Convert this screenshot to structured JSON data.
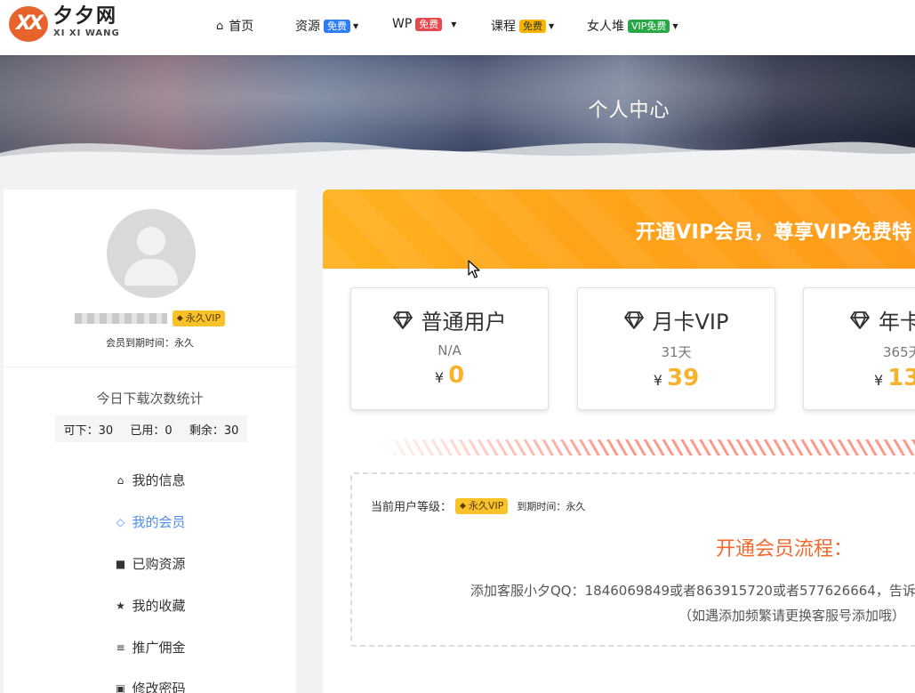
{
  "logo": {
    "mark": "XX",
    "cn": "夕夕网",
    "en": "XI XI WANG",
    "color": "#e8622b"
  },
  "nav": [
    {
      "label": "首页",
      "icon": "home-icon"
    },
    {
      "label": "资源",
      "tag": "免费",
      "tag_color": "blue"
    },
    {
      "label": "WP",
      "tag": "免费",
      "tag_color": "red"
    },
    {
      "label": "课程",
      "tag": "免费",
      "tag_color": "yellow"
    },
    {
      "label": "女人堆",
      "tag": "VIP免费",
      "tag_color": "green"
    }
  ],
  "banner": {
    "title": "个人中心"
  },
  "profile": {
    "vip_label": "永久VIP",
    "expire_text": "会员到期时间：永久"
  },
  "downloads": {
    "title": "今日下载次数统计",
    "available": "可下：30",
    "used": "已用：0",
    "remaining": "剩余：30"
  },
  "menu": [
    {
      "label": "我的信息",
      "icon": "home-icon",
      "active": false
    },
    {
      "label": "我的会员",
      "icon": "diamond-icon",
      "active": true
    },
    {
      "label": "已购资源",
      "icon": "bag-icon",
      "active": false
    },
    {
      "label": "我的收藏",
      "icon": "star-icon",
      "active": false
    },
    {
      "label": "推广佣金",
      "icon": "coins-icon",
      "active": false
    },
    {
      "label": "修改密码",
      "icon": "lock-icon",
      "active": false
    }
  ],
  "vip_header": {
    "text": "开通VIP会员，尊享VIP免费特"
  },
  "plans": [
    {
      "name": "普通用户",
      "duration": "N/A",
      "currency": "¥",
      "price": "0"
    },
    {
      "name": "月卡VIP",
      "duration": "31天",
      "currency": "¥",
      "price": "39"
    },
    {
      "name": "年卡",
      "duration": "365天",
      "currency": "¥",
      "price": "13"
    }
  ],
  "level": {
    "label": "当前用户等级：",
    "vip_label": "永久VIP",
    "expire": "到期时间：永久"
  },
  "flow": {
    "title": "开通会员流程：",
    "contact": "添加客服小夕QQ：1846069849或者863915720或者577626664，告诉",
    "tip": "（如遇添加频繁请更换客服号添加哦）"
  },
  "colors": {
    "accent": "#f7b32b",
    "active_menu": "#4d8ef0",
    "flow_title": "#f26a2e",
    "vip_gold": "#f8c32a"
  }
}
